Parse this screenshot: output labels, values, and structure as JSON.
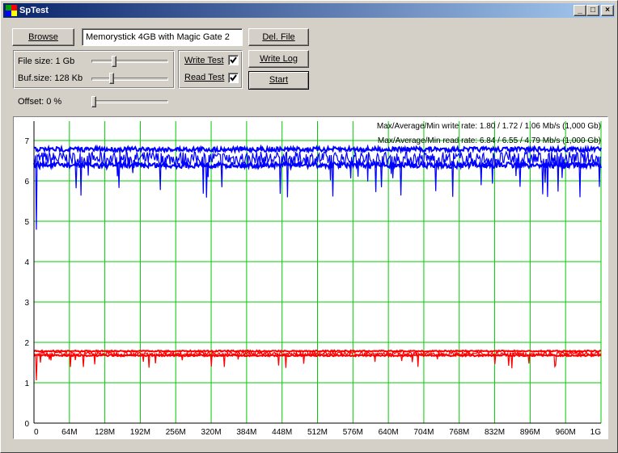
{
  "window": {
    "title": "SpTest",
    "minimize": "_",
    "maximize": "□",
    "close": "×"
  },
  "controls": {
    "browse_label": "Browse",
    "device_name": "Memorystick 4GB with Magic Gate 2",
    "del_file_label": "Del. File",
    "write_log_label": "Write Log",
    "start_label": "Start",
    "file_size_label": "File size: 1 Gb",
    "buf_size_label": "Buf.size: 128 Kb",
    "offset_label": "Offset: 0 %",
    "write_test_label": "Write Test",
    "read_test_label": "Read Test",
    "write_test_checked": true,
    "read_test_checked": true
  },
  "chart_data": {
    "type": "line",
    "ylim": [
      0,
      7
    ],
    "y_ticks": [
      "0",
      "1",
      "2",
      "3",
      "4",
      "5",
      "6",
      "7"
    ],
    "x_ticks": [
      "0",
      "64M",
      "128M",
      "192M",
      "256M",
      "320M",
      "384M",
      "448M",
      "512M",
      "576M",
      "640M",
      "704M",
      "768M",
      "832M",
      "896M",
      "960M",
      "1G"
    ],
    "annotations": {
      "write": "Max/Average/Min write rate: 1.80 / 1.72 / 1.06 Mb/s (1,000 Gb)",
      "read": "Max/Average/Min read rate: 6.84 / 6.55 / 4.79 Mb/s (1,000 Gb)"
    },
    "series": [
      {
        "color": "#0000ff",
        "max": 6.84,
        "avg": 6.55,
        "min": 4.79
      },
      {
        "color": "#ff0000",
        "max": 1.8,
        "avg": 1.72,
        "min": 1.06
      }
    ],
    "grid": true,
    "grid_color": "#00cc00"
  }
}
